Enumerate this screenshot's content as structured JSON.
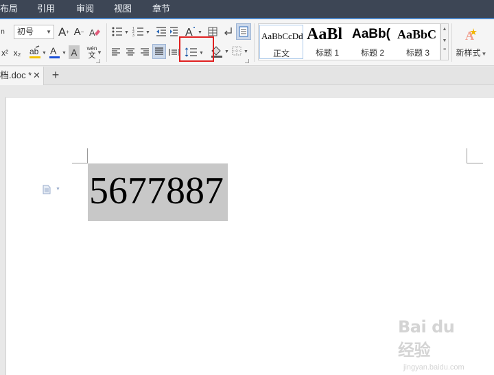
{
  "menu": {
    "items": [
      "布局",
      "引用",
      "审阅",
      "视图",
      "章节"
    ]
  },
  "toolbar": {
    "font_size_value": "初号",
    "grow_font_label": "A",
    "shrink_font_label": "A",
    "superscript_label": "x²",
    "subscript_label": "x₂",
    "font_color_label": "A",
    "char_shading_label": "A",
    "phonetic_top": "wén",
    "phonetic_bottom": "文",
    "text_effect_label": "A"
  },
  "styles": {
    "items": [
      {
        "preview": "AaBbCcDd",
        "label": "正文"
      },
      {
        "preview": "AaBl",
        "label": "标题 1"
      },
      {
        "preview": "AaBb(",
        "label": "标题 2"
      },
      {
        "preview": "AaBbC",
        "label": "标题 3"
      }
    ],
    "new_style_label": "新样式"
  },
  "tabs": {
    "doc_title": "档.doc *",
    "close": "✕",
    "new_tab": "+"
  },
  "document": {
    "selected_text": "5677887"
  },
  "watermark": {
    "brand": "Bai du 经验",
    "url": "jingyan.baidu.com"
  },
  "colors": {
    "menubar_bg": "#3d4655",
    "ribbon_accent": "#4a84c6",
    "highlight_box": "#e02020",
    "selection_bg": "#c8c8c8",
    "font_color_bar": "#1a4fd8",
    "highlight_bar": "#f2c200"
  }
}
